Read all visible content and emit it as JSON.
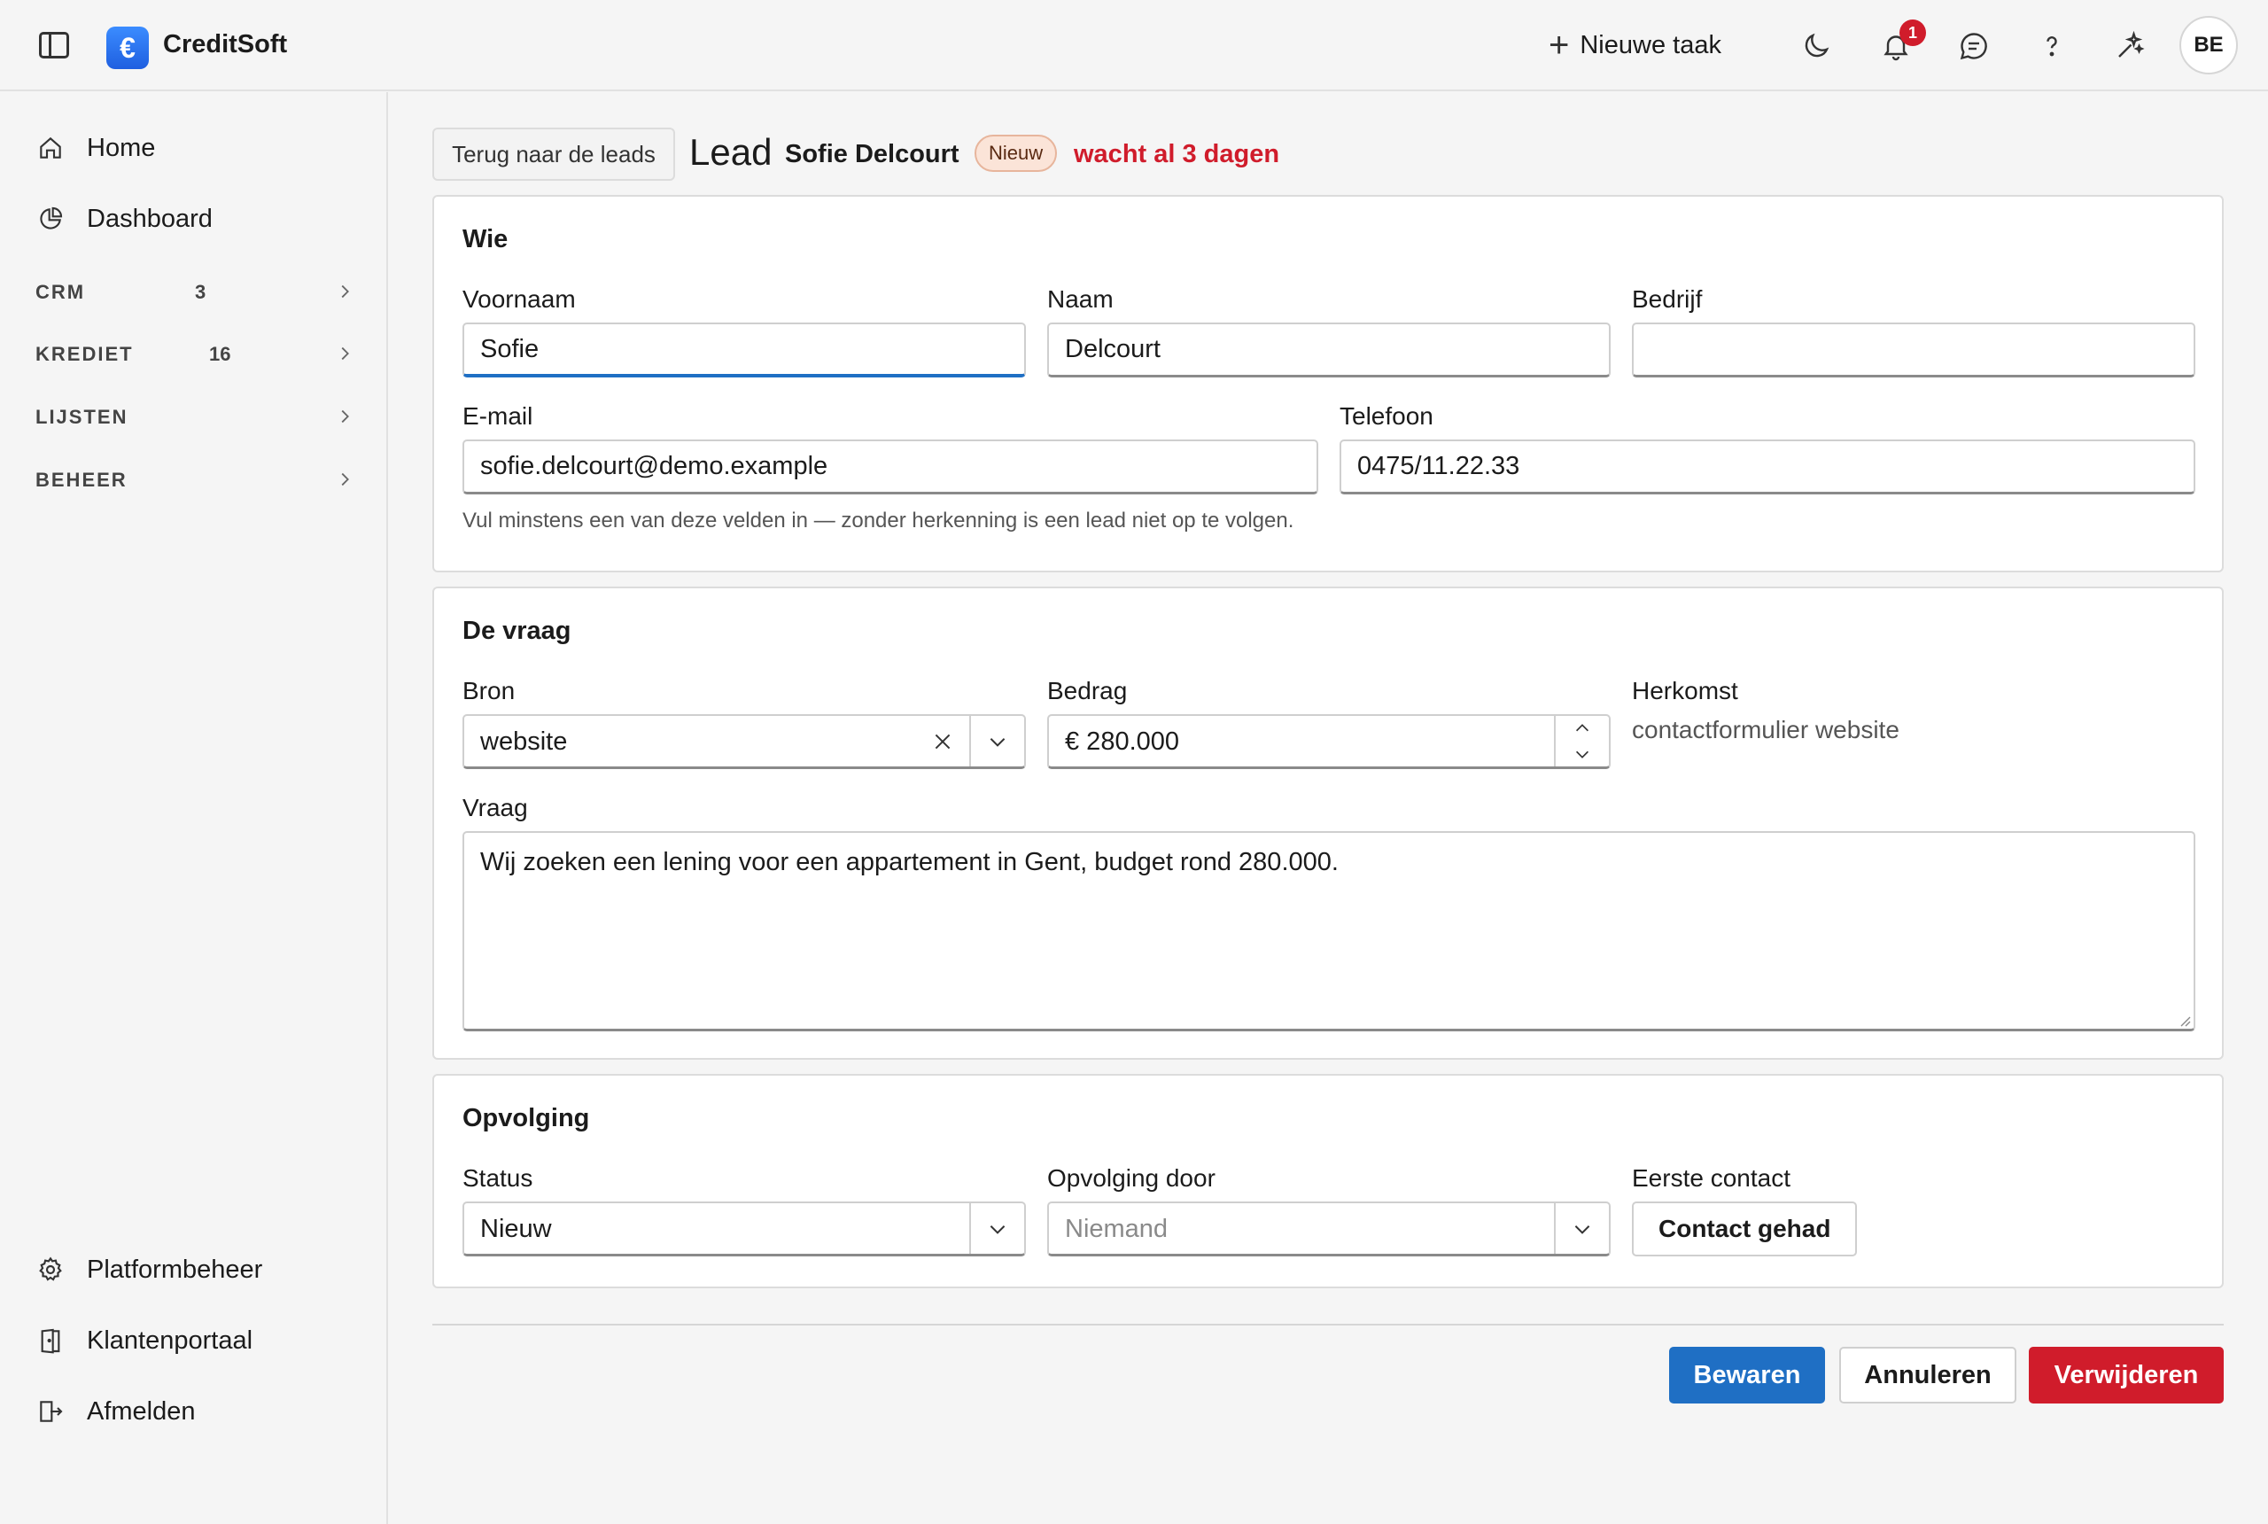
{
  "app": {
    "brand": "CreditSoft",
    "logo_symbol": "€"
  },
  "topbar": {
    "new_task": "Nieuwe taak",
    "notification_count": "1",
    "avatar": "BE",
    "icons": [
      "sidebar-toggle-icon",
      "moon-icon",
      "bell-icon",
      "chat-icon",
      "help-icon",
      "sparkle-icon"
    ]
  },
  "sidebar": {
    "home": "Home",
    "dashboard": "Dashboard",
    "groups": [
      {
        "label": "CRM",
        "count": "3"
      },
      {
        "label": "KREDIET",
        "count": "16"
      },
      {
        "label": "LIJSTEN",
        "count": ""
      },
      {
        "label": "BEHEER",
        "count": ""
      }
    ],
    "platform": "Platformbeheer",
    "portal": "Klantenportaal",
    "logout": "Afmelden"
  },
  "header": {
    "back": "Terug naar de leads",
    "title": "Lead",
    "name": "Sofie Delcourt",
    "status": "Nieuw",
    "waiting": "wacht al 3 dagen"
  },
  "wie": {
    "title": "Wie",
    "first_name_label": "Voornaam",
    "first_name": "Sofie",
    "last_name_label": "Naam",
    "last_name": "Delcourt",
    "company_label": "Bedrijf",
    "company": "",
    "email_label": "E-mail",
    "email": "sofie.delcourt@demo.example",
    "phone_label": "Telefoon",
    "phone": "0475/11.22.33",
    "hint": "Vul minstens een van deze velden in — zonder herkenning is een lead niet op te volgen."
  },
  "vraag": {
    "title": "De vraag",
    "source_label": "Bron",
    "source": "website",
    "amount_label": "Bedrag",
    "amount": "€ 280.000",
    "origin_label": "Herkomst",
    "origin": "contactformulier website",
    "question_label": "Vraag",
    "question": "Wij zoeken een lening voor een appartement in Gent, budget rond 280.000."
  },
  "opvolging": {
    "title": "Opvolging",
    "status_label": "Status",
    "status": "Nieuw",
    "owner_label": "Opvolging door",
    "owner_placeholder": "Niemand",
    "first_contact_label": "Eerste contact",
    "contact_button": "Contact gehad"
  },
  "actions": {
    "save": "Bewaren",
    "cancel": "Annuleren",
    "delete": "Verwijderen"
  },
  "colors": {
    "primary": "#1f6fc4",
    "danger": "#d01c2b",
    "pill_bg": "#fbe4d8"
  }
}
